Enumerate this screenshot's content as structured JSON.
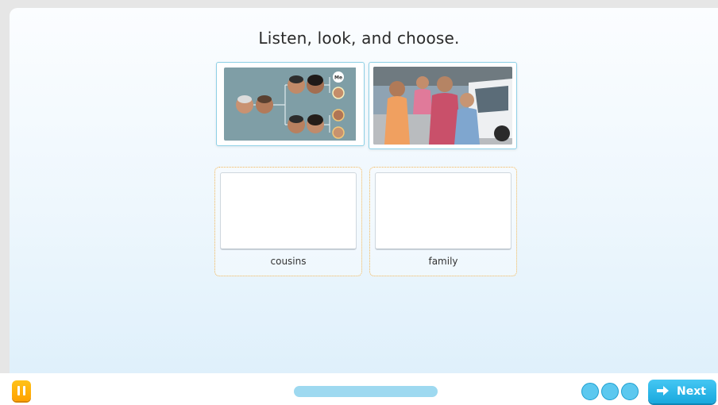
{
  "instruction": "Listen, look, and choose.",
  "images": [
    {
      "name": "family-tree-image",
      "depicts": "family-tree",
      "me_label": "Me"
    },
    {
      "name": "family-photo-image",
      "depicts": "family-photo"
    }
  ],
  "targets": [
    {
      "label": "cousins"
    },
    {
      "label": "family"
    }
  ],
  "footer": {
    "next_label": "Next"
  },
  "colors": {
    "accent": "#19a8de",
    "pause": "#ffa200",
    "drop_border": "#f0b65a",
    "card_border": "#8ed0e6"
  }
}
